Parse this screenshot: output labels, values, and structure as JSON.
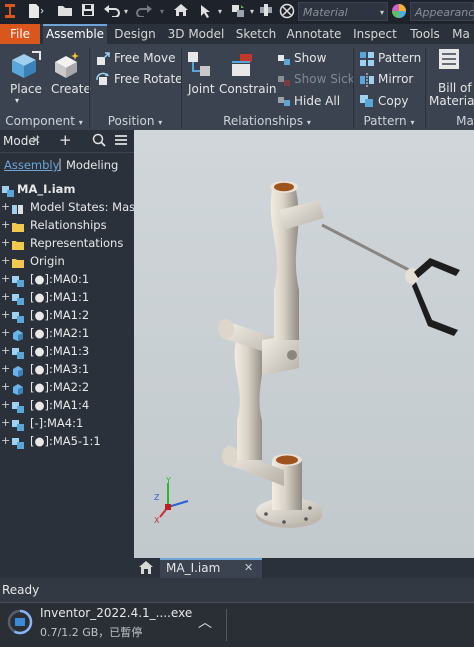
{
  "quick_access": {
    "material_placeholder": "Material",
    "appearance_placeholder": "Appearance"
  },
  "tabs": [
    "File",
    "Assemble",
    "Design",
    "3D Model",
    "Sketch",
    "Annotate",
    "Inspect",
    "Tools",
    "Ma"
  ],
  "ribbon": {
    "place": "Place",
    "create": "Create",
    "free_move": "Free Move",
    "free_rotate": "Free Rotate",
    "joint": "Joint",
    "constrain": "Constrain",
    "show": "Show",
    "show_sick": "Show Sick",
    "hide_all": "Hide All",
    "pattern": "Pattern",
    "mirror": "Mirror",
    "copy": "Copy",
    "bill_of_materials_1": "Bill of",
    "bill_of_materials_2": "Materials",
    "panels": {
      "component": "Component",
      "position": "Position",
      "relationships": "Relationships",
      "pattern": "Pattern",
      "more": "Ma"
    }
  },
  "browser": {
    "title": "Model",
    "add": "+",
    "view_assembly": "Assembly",
    "divider": "|",
    "view_modeling": "Modeling",
    "root": "MA_I.iam",
    "items": [
      {
        "label": "Model States: Master",
        "icon": "model-states-icon"
      },
      {
        "label": "Relationships",
        "icon": "folder-icon"
      },
      {
        "label": "Representations",
        "icon": "folder-icon"
      },
      {
        "label": "Origin",
        "icon": "folder-icon"
      },
      {
        "label": "[●]:MA0:1",
        "icon": "assembly-icon"
      },
      {
        "label": "[●]:MA1:1",
        "icon": "assembly-icon"
      },
      {
        "label": "[●]:MA1:2",
        "icon": "assembly-icon"
      },
      {
        "label": "[●]:MA2:1",
        "icon": "part-icon"
      },
      {
        "label": "[●]:MA1:3",
        "icon": "assembly-icon"
      },
      {
        "label": "[●]:MA3:1",
        "icon": "part-icon"
      },
      {
        "label": "[●]:MA2:2",
        "icon": "part-icon"
      },
      {
        "label": "[●]:MA1:4",
        "icon": "assembly-icon"
      },
      {
        "label": "[-]:MA4:1",
        "icon": "assembly-icon"
      },
      {
        "label": "[●]:MA5-1:1",
        "icon": "assembly-icon"
      }
    ]
  },
  "document_tab": "MA_I.iam",
  "status": "Ready",
  "download": {
    "file_name": "Inventor_2022.4.1_....exe",
    "progress_text": "0.7/1.2 GB，已暫停",
    "progress_fraction": 0.58
  },
  "colors": {
    "file_tab": "#d9561c",
    "ribbon_bg": "#3b4350",
    "viewport_bg": "#c8ced2",
    "accent_blue": "#6fa4d8"
  }
}
